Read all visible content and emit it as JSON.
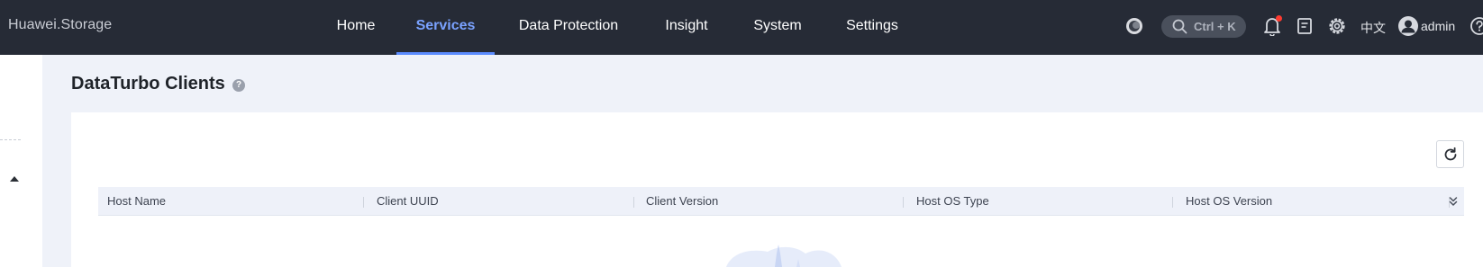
{
  "app": {
    "brand": "Huawei.Storage"
  },
  "nav": {
    "tabs": [
      {
        "label": "Home",
        "active": false
      },
      {
        "label": "Services",
        "active": true
      },
      {
        "label": "Data Protection",
        "active": false
      },
      {
        "label": "Insight",
        "active": false
      },
      {
        "label": "System",
        "active": false
      },
      {
        "label": "Settings",
        "active": false
      }
    ]
  },
  "toolbar": {
    "search_shortcut": "Ctrl + K",
    "language": "中文",
    "user": "admin",
    "has_notification": true,
    "icons": [
      "theme-icon",
      "search-icon",
      "bell-icon",
      "document-icon",
      "gear-icon",
      "user-avatar-icon",
      "help-icon"
    ]
  },
  "page": {
    "title": "DataTurbo Clients",
    "help_icon": "?"
  },
  "table": {
    "columns": [
      "Host Name",
      "Client UUID",
      "Client Version",
      "Host OS Type",
      "Host OS Version"
    ],
    "rows": []
  },
  "colors": {
    "topbar": "#262b36",
    "accent": "#5b8cff",
    "page_bg": "#eff2f9",
    "header_bg": "#eef1f9"
  }
}
